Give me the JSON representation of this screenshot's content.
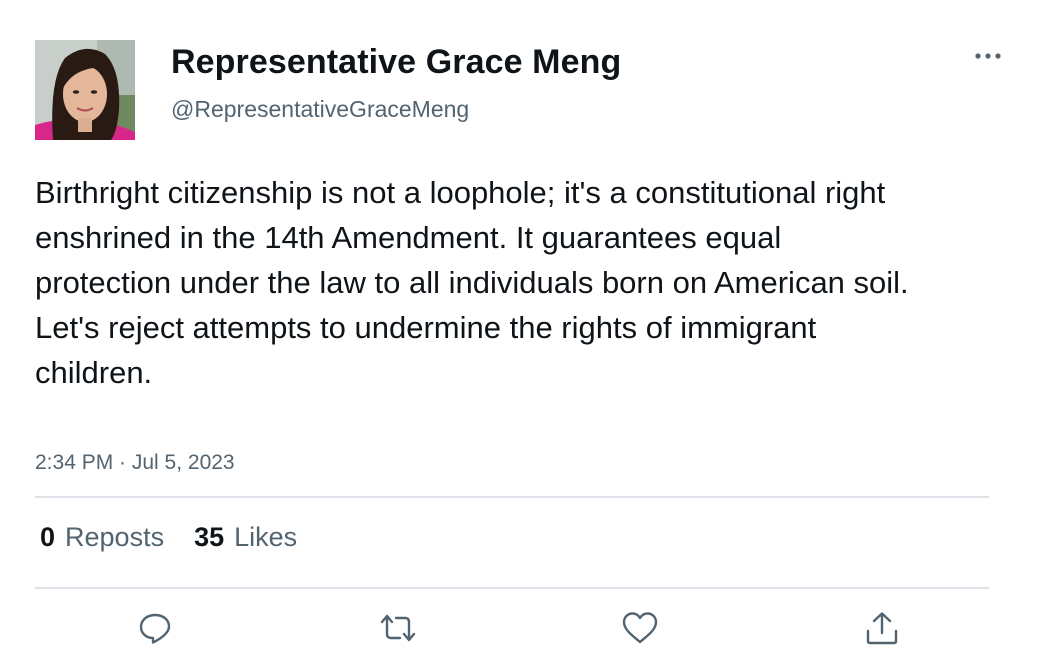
{
  "author": {
    "display_name": "Representative Grace Meng",
    "handle": "@RepresentativeGraceMeng"
  },
  "tweet": {
    "text": "Birthright citizenship is not a loophole; it's a constitutional right enshrined in the 14th Amendment. It guarantees equal protection under the law to all individuals born on American soil. Let's reject attempts to undermine the rights of immigrant children.",
    "timestamp": "2:34 PM · Jul 5, 2023"
  },
  "stats": {
    "reposts_count": "0",
    "reposts_label": "Reposts",
    "likes_count": "35",
    "likes_label": "Likes"
  },
  "icons": {
    "more": "more-dots-icon",
    "reply": "reply-icon",
    "repost": "repost-icon",
    "like": "heart-icon",
    "share": "share-icon"
  },
  "colors": {
    "text_primary": "#0f1419",
    "text_secondary": "#536471",
    "divider": "#dde3e8",
    "icon": "#536471"
  }
}
